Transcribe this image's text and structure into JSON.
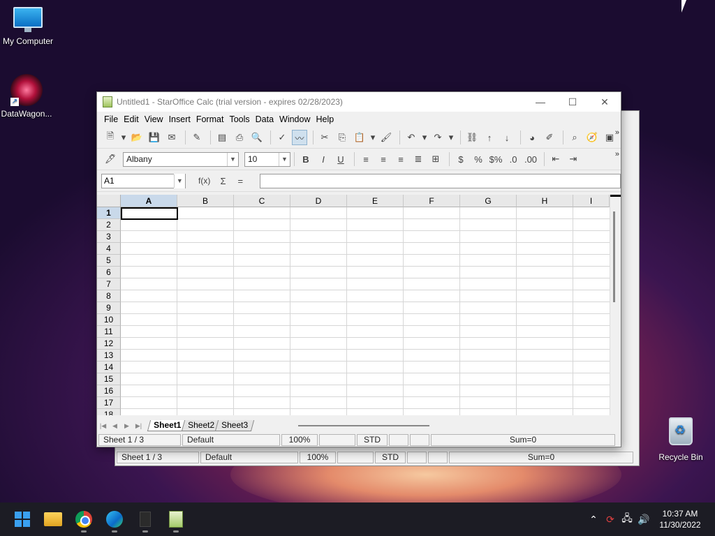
{
  "desktop": {
    "icons": [
      {
        "label": "My Computer"
      },
      {
        "label": "DataWagon..."
      },
      {
        "label": "Recycle Bin"
      }
    ]
  },
  "window": {
    "title": "Untitled1 - StarOffice Calc (trial version - expires 02/28/2023)",
    "menu": [
      "File",
      "Edit",
      "View",
      "Insert",
      "Format",
      "Tools",
      "Data",
      "Window",
      "Help"
    ],
    "font_name": "Albany",
    "font_size": "10",
    "name_box": "A1",
    "formula_symbols": {
      "fx": "f(x)",
      "sum": "Σ",
      "equals": "="
    },
    "columns": [
      "A",
      "B",
      "C",
      "D",
      "E",
      "F",
      "G",
      "H",
      "I"
    ],
    "rows": [
      "1",
      "2",
      "3",
      "4",
      "5",
      "6",
      "7",
      "8",
      "9",
      "10",
      "11",
      "12",
      "13",
      "14",
      "15",
      "16",
      "17",
      "18"
    ],
    "sheets": [
      "Sheet1",
      "Sheet2",
      "Sheet3"
    ],
    "status": {
      "sheet": "Sheet 1 / 3",
      "style": "Default",
      "zoom": "100%",
      "mode": "STD",
      "sum": "Sum=0"
    }
  },
  "background_window": {
    "status": {
      "sheet": "Sheet 1 / 3",
      "style": "Default",
      "zoom": "100%",
      "mode": "STD",
      "sum": "Sum=0"
    }
  },
  "taskbar": {
    "time": "10:37 AM",
    "date": "11/30/2022"
  }
}
